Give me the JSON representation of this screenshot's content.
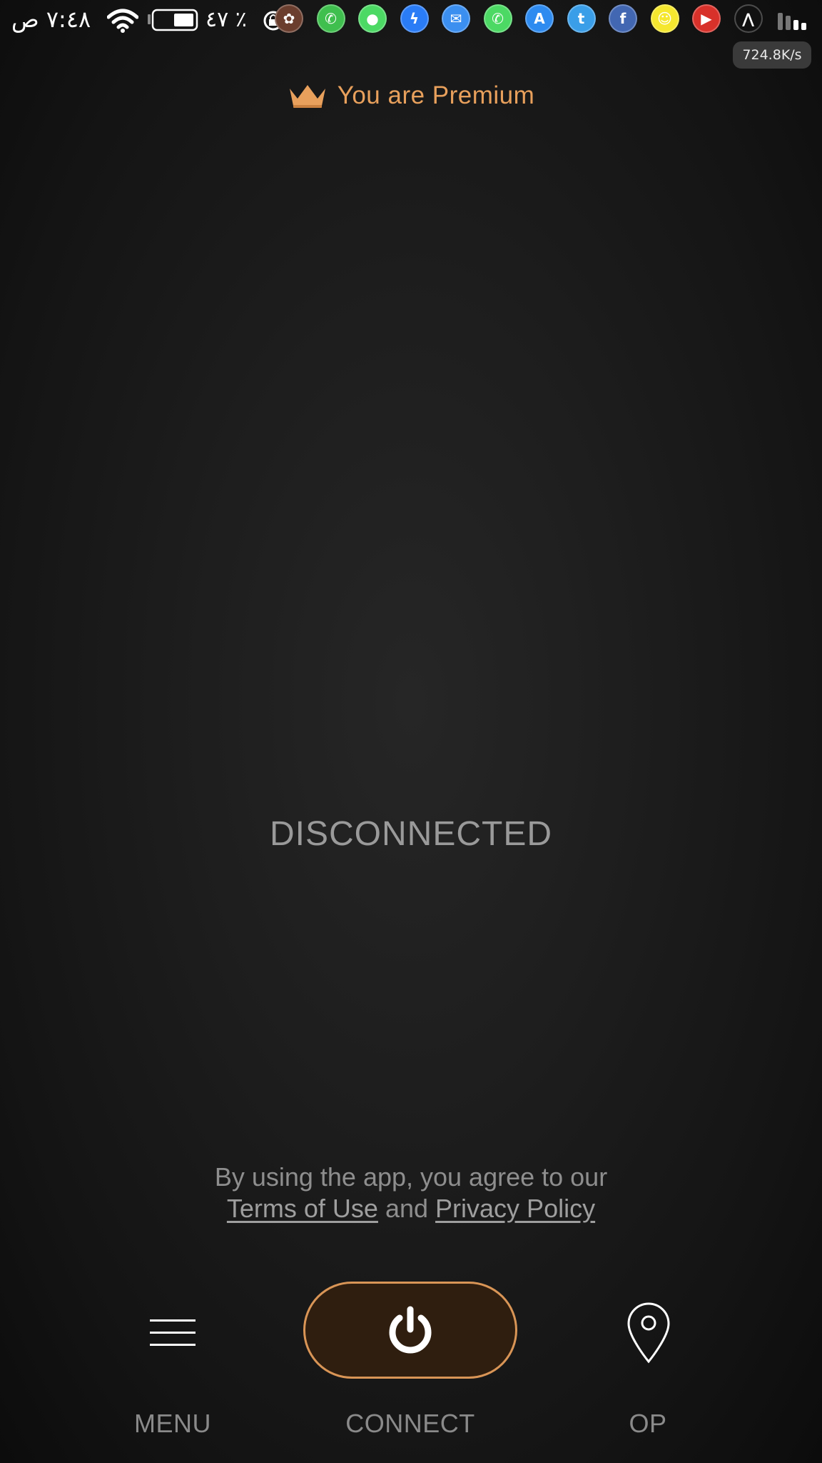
{
  "status_bar": {
    "time": "٧:٤٨ ص",
    "battery_percent": "٪ ٤٧",
    "net_speed": "724.8K/s",
    "notification_icons": [
      {
        "name": "cydia-icon",
        "glyph": "✿",
        "color": "#6b3e2e"
      },
      {
        "name": "whatsapp-icon",
        "glyph": "✆",
        "color": "#3fbf4e"
      },
      {
        "name": "messages-icon",
        "glyph": "●",
        "color": "#4cd964"
      },
      {
        "name": "messenger-icon",
        "glyph": "ϟ",
        "color": "#2a7cf6"
      },
      {
        "name": "mail-icon",
        "glyph": "✉",
        "color": "#3b8ff0"
      },
      {
        "name": "phone-icon",
        "glyph": "✆",
        "color": "#4cd964"
      },
      {
        "name": "app-store-icon",
        "glyph": "A",
        "color": "#2e8bf0"
      },
      {
        "name": "twitter-icon",
        "glyph": "t",
        "color": "#3a9ee8"
      },
      {
        "name": "facebook-icon",
        "glyph": "f",
        "color": "#4267b2"
      },
      {
        "name": "snapchat-icon",
        "glyph": "☺",
        "color": "#f5e72f"
      },
      {
        "name": "youtube-icon",
        "glyph": "▶",
        "color": "#d8312a"
      },
      {
        "name": "vpn-app-icon",
        "glyph": "⋀",
        "color": "#111111"
      }
    ]
  },
  "header": {
    "premium_label": "You are Premium",
    "accent_color": "#e8a05c"
  },
  "main": {
    "connection_status": "DISCONNECTED"
  },
  "legal": {
    "line1": "By using the app, you agree to our",
    "terms_label": "Terms of Use",
    "and_text": " and ",
    "privacy_label": "Privacy Policy"
  },
  "bottom_nav": {
    "menu_label": "MENU",
    "connect_label": "CONNECT",
    "location_label": "OP"
  }
}
